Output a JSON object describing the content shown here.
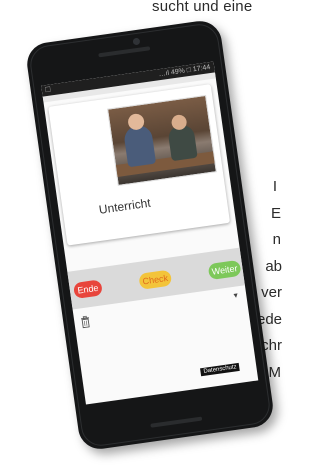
{
  "background_text": {
    "top": "sucht und eine",
    "right_lines": [
      "I",
      "E",
      "n",
      "ab",
      "ver",
      "jede",
      "schr",
      "für M"
    ]
  },
  "status_bar": {
    "text": "…ıl 49% □ 17:44",
    "menu_icon": "menu-icon"
  },
  "card": {
    "label": "Unterricht",
    "image_icon": "classroom-photo"
  },
  "buttons": {
    "ende": "Ende",
    "check": "Check",
    "weiter": "Weiter"
  },
  "icons": {
    "trash": "trash-icon",
    "dropdown": "caret-down-icon"
  },
  "footer": {
    "privacy": "Datenschutz"
  },
  "colors": {
    "ende": "#e8453c",
    "check": "#f3c43a",
    "weiter": "#7dc85a",
    "phone": "#151617"
  }
}
